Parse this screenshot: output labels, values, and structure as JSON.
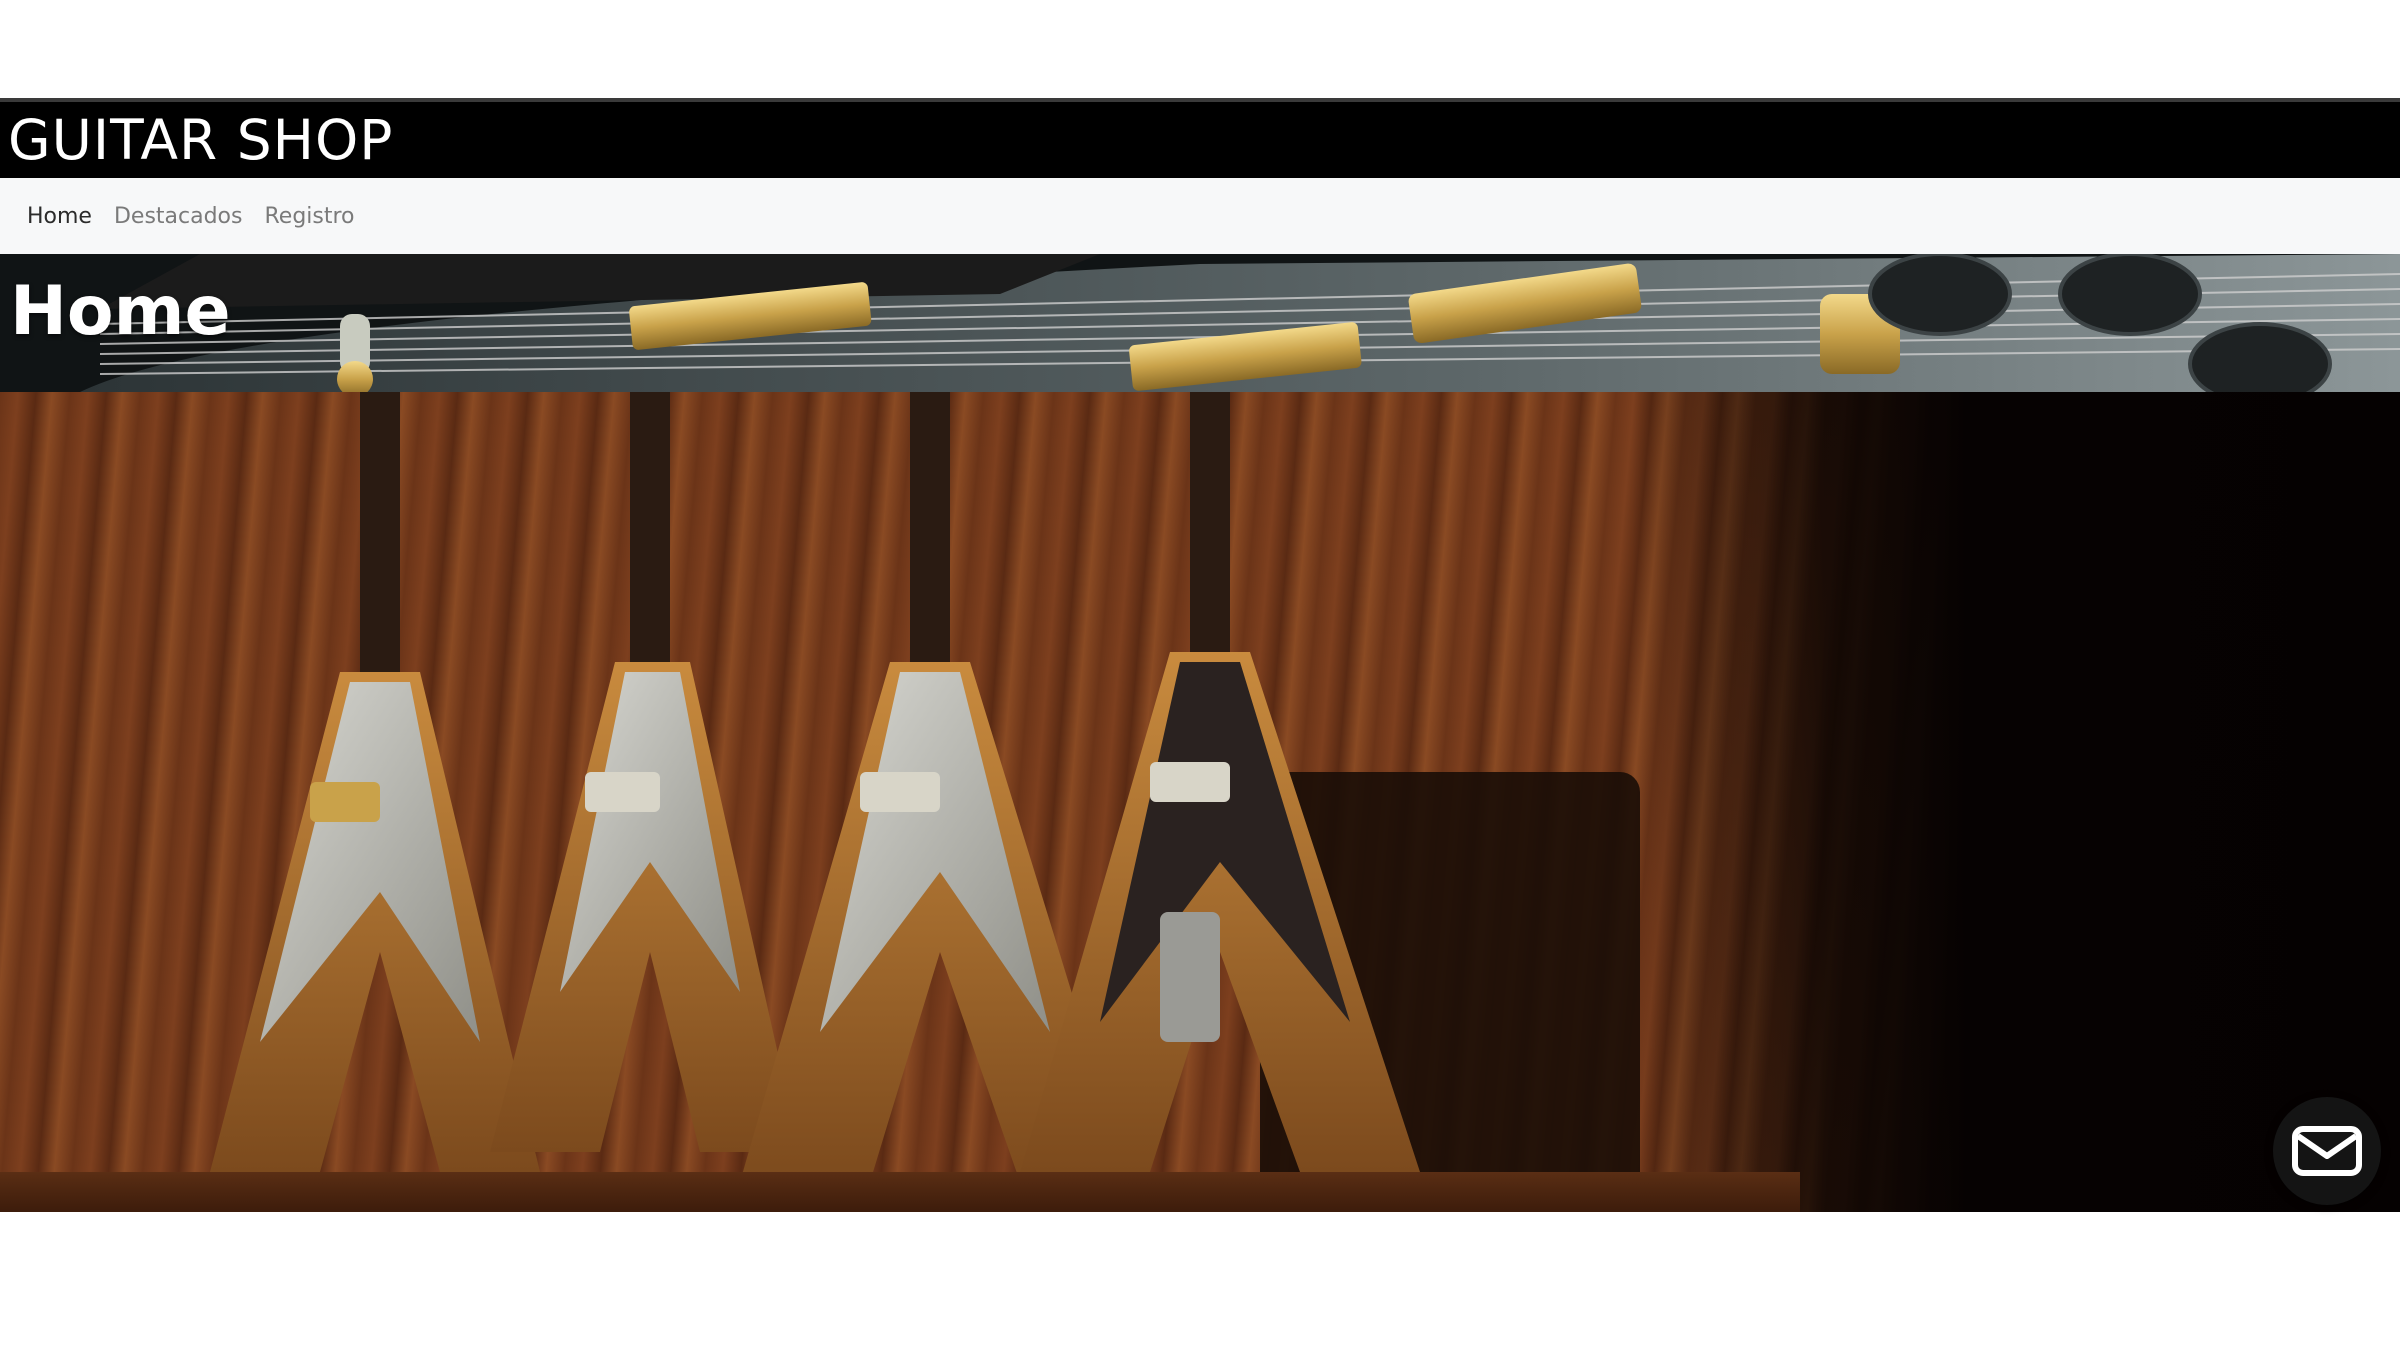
{
  "brand": {
    "title": "GUITAR SHOP"
  },
  "nav": {
    "items": [
      {
        "label": "Home"
      },
      {
        "label": "Destacados"
      },
      {
        "label": "Registro"
      }
    ]
  },
  "page": {
    "title": "Home"
  },
  "colors": {
    "header_bg": "#000000",
    "nav_bg": "#f7f8f9",
    "nav_active": "#2b2b2b",
    "nav_inactive": "#7a7a7a"
  },
  "icons": {
    "contact": "envelope-icon"
  }
}
